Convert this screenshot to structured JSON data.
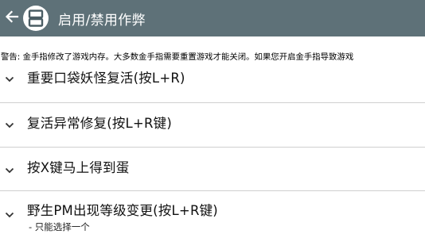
{
  "app_bar": {
    "back_icon": "arrow-left-icon",
    "logo_icon": "nintendo-ds-icon",
    "title": "启用/禁用作弊",
    "background": "#5e7178"
  },
  "warning_text": "警告: 金手指修改了游戏内存。大多数金手指需要重置游戏才能关闭。如果您开启金手指导致游戏",
  "cheats": [
    {
      "name": "重要口袋妖怪复活(按L+R)",
      "description": ""
    },
    {
      "name": "复活异常修复(按L+R键)",
      "description": ""
    },
    {
      "name": "按X键马上得到蛋",
      "description": ""
    },
    {
      "name": "野生PM出现等级变更(按L+R键)",
      "description": "- 只能选择一个"
    }
  ]
}
